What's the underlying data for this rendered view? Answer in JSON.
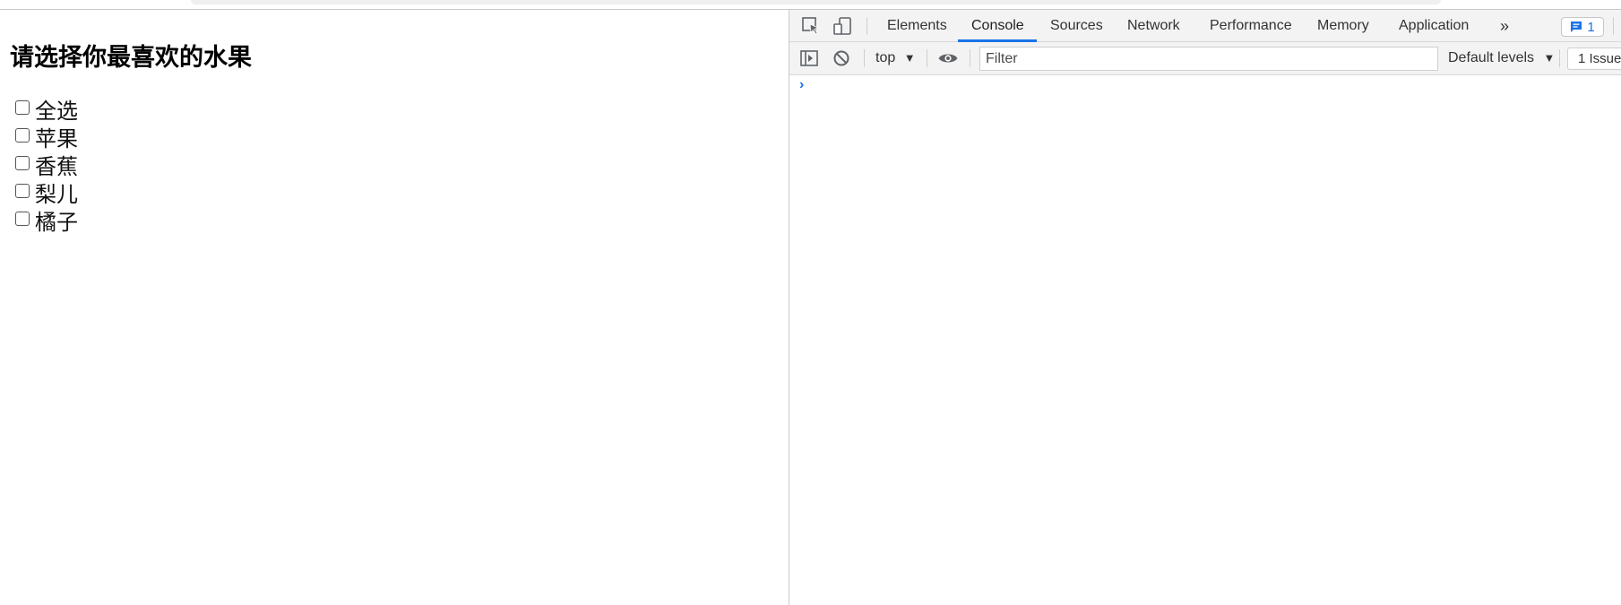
{
  "page": {
    "heading": "请选择你最喜欢的水果",
    "checkboxes": [
      {
        "label": "全选",
        "checked": false
      },
      {
        "label": "苹果",
        "checked": false
      },
      {
        "label": "香蕉",
        "checked": false
      },
      {
        "label": "梨儿",
        "checked": false
      },
      {
        "label": "橘子",
        "checked": false
      }
    ]
  },
  "devtools": {
    "tabs": [
      "Elements",
      "Console",
      "Sources",
      "Network",
      "Performance",
      "Memory",
      "Application"
    ],
    "active_tab": "Console",
    "more_tabs": "»",
    "issues_badge_count": "1",
    "toolbar": {
      "context": "top",
      "filter_placeholder": "Filter",
      "levels": "Default levels",
      "issues_button": "1 Issue"
    },
    "console_prompt": "›",
    "accent_color": "#1a73e8"
  }
}
